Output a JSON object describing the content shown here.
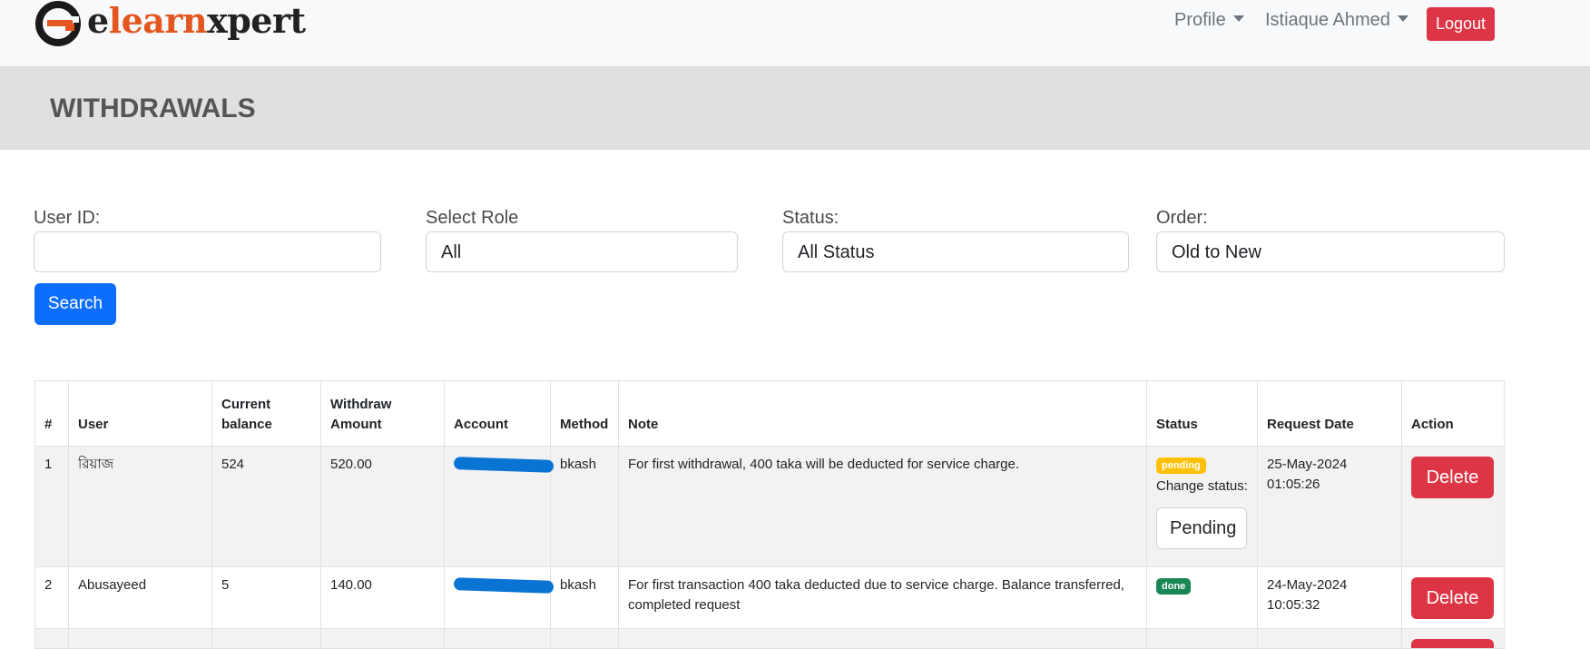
{
  "navbar": {
    "logo": {
      "prefix": "e",
      "middle": "learn",
      "suffix": "xpert"
    },
    "profile_label": "Profile",
    "user_label": "Istiaque Ahmed",
    "logout_label": "Logout"
  },
  "page_title": "WITHDRAWALS",
  "filters": {
    "user_id": {
      "label": "User ID:",
      "value": ""
    },
    "role": {
      "label": "Select Role",
      "value": "All"
    },
    "status": {
      "label": "Status:",
      "value": "All Status"
    },
    "order": {
      "label": "Order:",
      "value": "Old to New"
    },
    "search_label": "Search"
  },
  "table": {
    "headers": [
      "#",
      "User",
      "Current balance",
      "Withdraw Amount",
      "Account",
      "Method",
      "Note",
      "Status",
      "Request Date",
      "Action"
    ],
    "rows": [
      {
        "num": "1",
        "user": "রিয়াজ",
        "balance": "524",
        "amount": "520.00",
        "method": "bkash",
        "note": "For first withdrawal, 400 taka will be deducted for service charge.",
        "status": "pending",
        "change_status_label": "Change status:",
        "status_select_value": "Pending",
        "date": "25-May-2024",
        "time": "01:05:26",
        "action": "Delete"
      },
      {
        "num": "2",
        "user": "Abusayeed",
        "balance": "5",
        "amount": "140.00",
        "method": "bkash",
        "note": "For first transaction 400 taka deducted due to service charge. Balance transferred, completed request",
        "status": "done",
        "date": "24-May-2024",
        "time": "10:05:32",
        "action": "Delete"
      }
    ]
  },
  "colors": {
    "primary": "#0d6efd",
    "danger": "#dc3545",
    "warning": "#ffc107",
    "success": "#198754",
    "brand_orange": "#e4561f"
  }
}
